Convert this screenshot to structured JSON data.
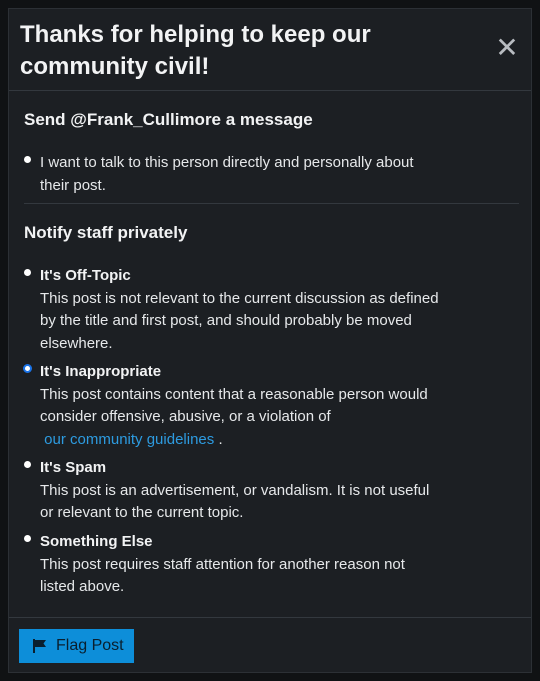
{
  "modal": {
    "title": "Thanks for helping to keep our community civil!",
    "close_glyph": "✕"
  },
  "message_section": {
    "title": "Send @Frank_Cullimore a message",
    "option": {
      "text": "I want to talk to this person directly and personally about their post."
    }
  },
  "staff_section": {
    "title": "Notify staff privately",
    "options": [
      {
        "label": "It's Off-Topic",
        "description": "This post is not relevant to the current discussion as defined by the title and first post, and should probably be moved elsewhere.",
        "selected": false
      },
      {
        "label": "It's Inappropriate",
        "description": "This post contains content that a reasonable person would consider offensive, abusive, or a violation of",
        "link_text": "our community guidelines",
        "suffix": ".",
        "selected": true
      },
      {
        "label": "It's Spam",
        "description": "This post is an advertisement, or vandalism. It is not useful or relevant to the current topic.",
        "selected": false
      },
      {
        "label": "Something Else",
        "description": "This post requires staff attention for another reason not listed above.",
        "selected": false
      }
    ]
  },
  "footer": {
    "flag_button_label": "Flag Post",
    "flag_icon": "flag-icon"
  },
  "colors": {
    "accent": "#0d8ed9",
    "link": "#2d9be0",
    "modal_bg": "#1c1f23",
    "radio_selected": "#1a73e8"
  }
}
